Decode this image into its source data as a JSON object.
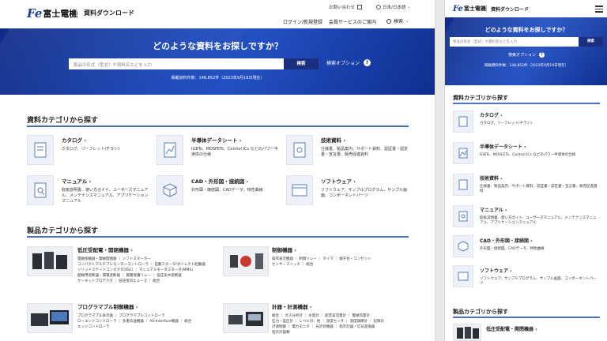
{
  "header": {
    "logo_mark": "Fe",
    "company": "富士電機",
    "section": "資料ダウンロード",
    "contact": "お問い合わせ",
    "language": "日本/日本語",
    "login": "ログイン/新規登録",
    "member": "会員サービスのご案内",
    "search": "検索"
  },
  "hero": {
    "question": "どのような資料をお探しですか？",
    "placeholder": "製品の形式（型式）や資料名などを入力",
    "placeholder_mobile": "製品の形式（型式）や資料名などを入力",
    "search_button": "検索",
    "option": "検索オプション",
    "count": "掲載資料件数：148,852件（2023年9月19日現在）"
  },
  "doc_section": {
    "title": "資料カテゴリから探す",
    "items": [
      {
        "title": "カタログ",
        "desc": "カタログ、リーフレット(チラシ)"
      },
      {
        "title": "半導体データシート",
        "desc": "IGBTs、MOSFETs、Control ICs などのパワー半導体の仕様"
      },
      {
        "title": "技術資料",
        "desc": "仕様書、製品案内、サポート資料、認証書・認定書・宣言書、販売促進資料"
      },
      {
        "title": "マニュアル",
        "desc": "取扱説明書、使い方ガイド、ユーザーズマニュアル、メンテナンスマニュアル、アプリケーションマニュアル"
      },
      {
        "title": "CAD・外形図・接続図",
        "desc": "外形図・接続図、CADデータ、特性曲線"
      },
      {
        "title": "ソフトウェア",
        "desc": "ソフトウェア、サンプルプログラム、サンプル画面、コンポーネントパーツ"
      }
    ]
  },
  "prod_section": {
    "title": "製品カテゴリから探す",
    "items": [
      {
        "title": "低圧受配電・開閉機器",
        "lines": [
          "電磁接触器・電磁開閉器 ｜ ソフトスターター",
          "コンパクトマルチプレモーターコントローラ ｜ 自動スタータ/ダイレクト起動器",
          "ソリッドステートコンタクタ(SSC) ｜ マニュアルモータスタータ(MMS)",
          "配線用遮断器・漏電遮断器 ｜ 漏電保護リレー ｜ 低圧気中遮断器",
          "サーキットプロテクタ ｜ 低圧限流ヒューズ ｜ 総合"
        ]
      },
      {
        "title": "制御機器",
        "lines": [
          "操作表示機器 ｜ 制御リレー ｜ タイマ ｜ 端子台・コンセント",
          "センサ・スイッチ ｜ 総合"
        ]
      },
      {
        "title": "プログラマブル制御機器",
        "lines": [
          "プログラマブル表示器 ｜ プログラマブルコントローラ",
          "ローエンドコントローラ ｜ 多重伝送機器 ｜ AS-Interface機器 ｜ 総合",
          "エッジコントローラ"
        ]
      },
      {
        "title": "計器・計測機器",
        "lines": [
          "総合 ｜ ガス分析計 ｜ 水質計 ｜ 超音波流量計 ｜ 電磁流量計",
          "圧力・差圧計 ｜ レベル計、他 ｜ 温度センサ ｜ 温度調節計 ｜ 記録計",
          "計測制御 ｜ 電力モニタ ｜ 光計装機器 ｜ 指示計器・信号変換器",
          "指示計器類"
        ]
      }
    ]
  },
  "mobile": {
    "menu": "メニュー"
  }
}
